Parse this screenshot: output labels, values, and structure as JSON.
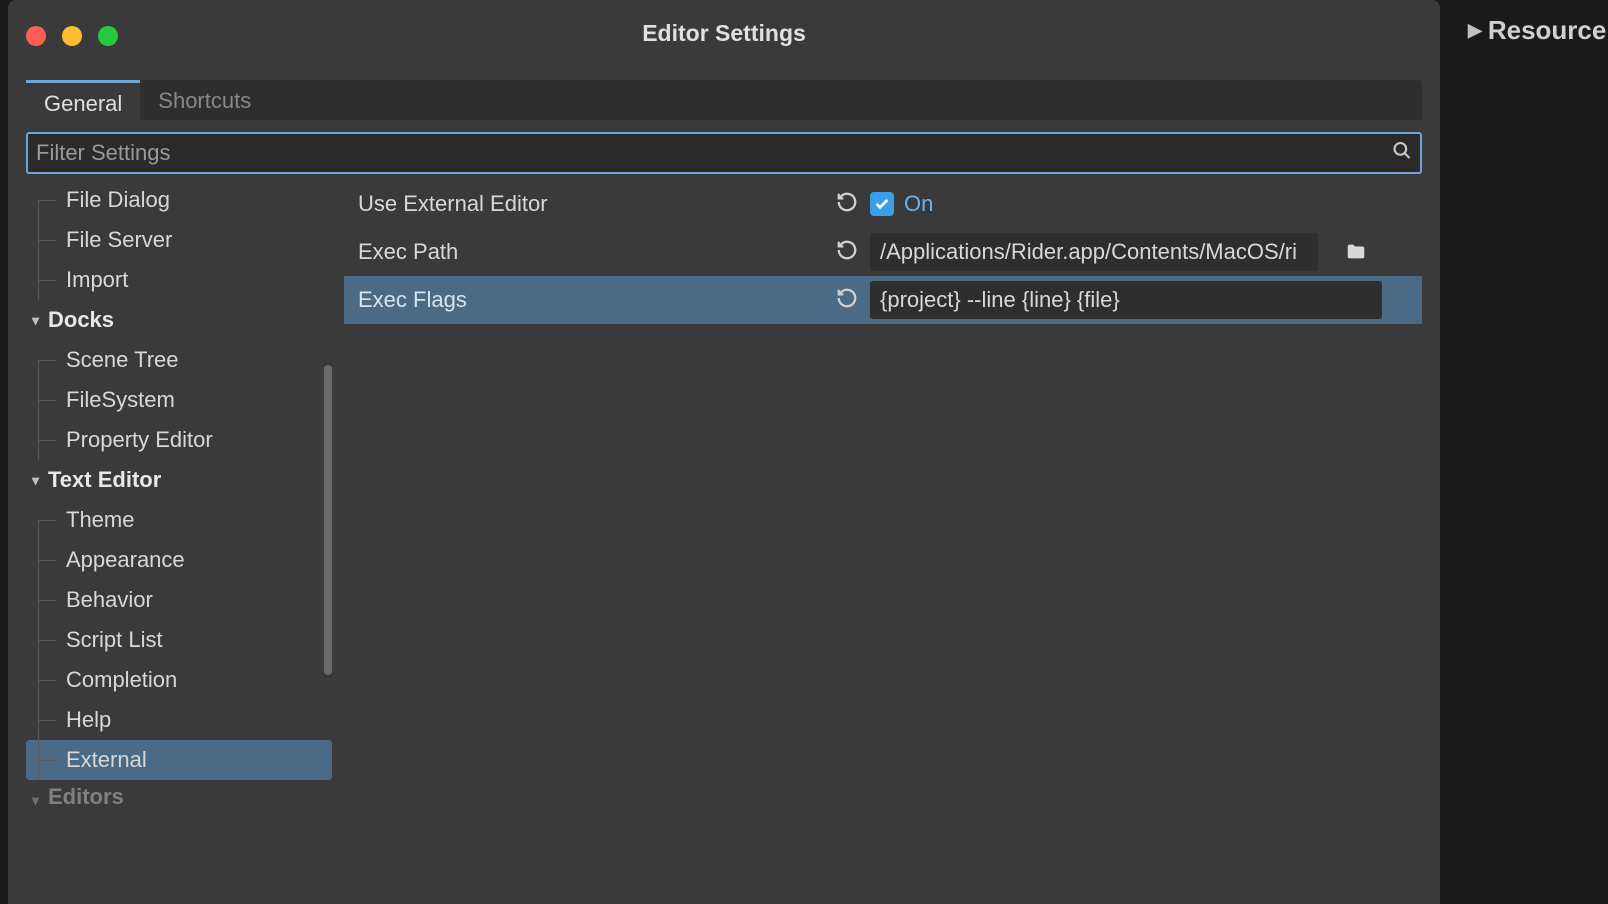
{
  "bg": {
    "resource_label": "Resource"
  },
  "window": {
    "title": "Editor Settings",
    "tabs": {
      "general": "General",
      "shortcuts": "Shortcuts"
    },
    "search": {
      "placeholder": "Filter Settings"
    }
  },
  "sidebar": {
    "top_items": [
      "File Dialog",
      "File Server",
      "Import"
    ],
    "groups": [
      {
        "header": "Docks",
        "items": [
          "Scene Tree",
          "FileSystem",
          "Property Editor"
        ]
      },
      {
        "header": "Text Editor",
        "items": [
          "Theme",
          "Appearance",
          "Behavior",
          "Script List",
          "Completion",
          "Help",
          "External"
        ]
      },
      {
        "header": "Editors",
        "items": []
      }
    ],
    "selected": "External"
  },
  "properties": {
    "use_external_editor": {
      "label": "Use External Editor",
      "value_label": "On",
      "checked": true
    },
    "exec_path": {
      "label": "Exec Path",
      "value": "/Applications/Rider.app/Contents/MacOS/ri"
    },
    "exec_flags": {
      "label": "Exec Flags",
      "value": "{project} --line {line} {file}"
    }
  }
}
